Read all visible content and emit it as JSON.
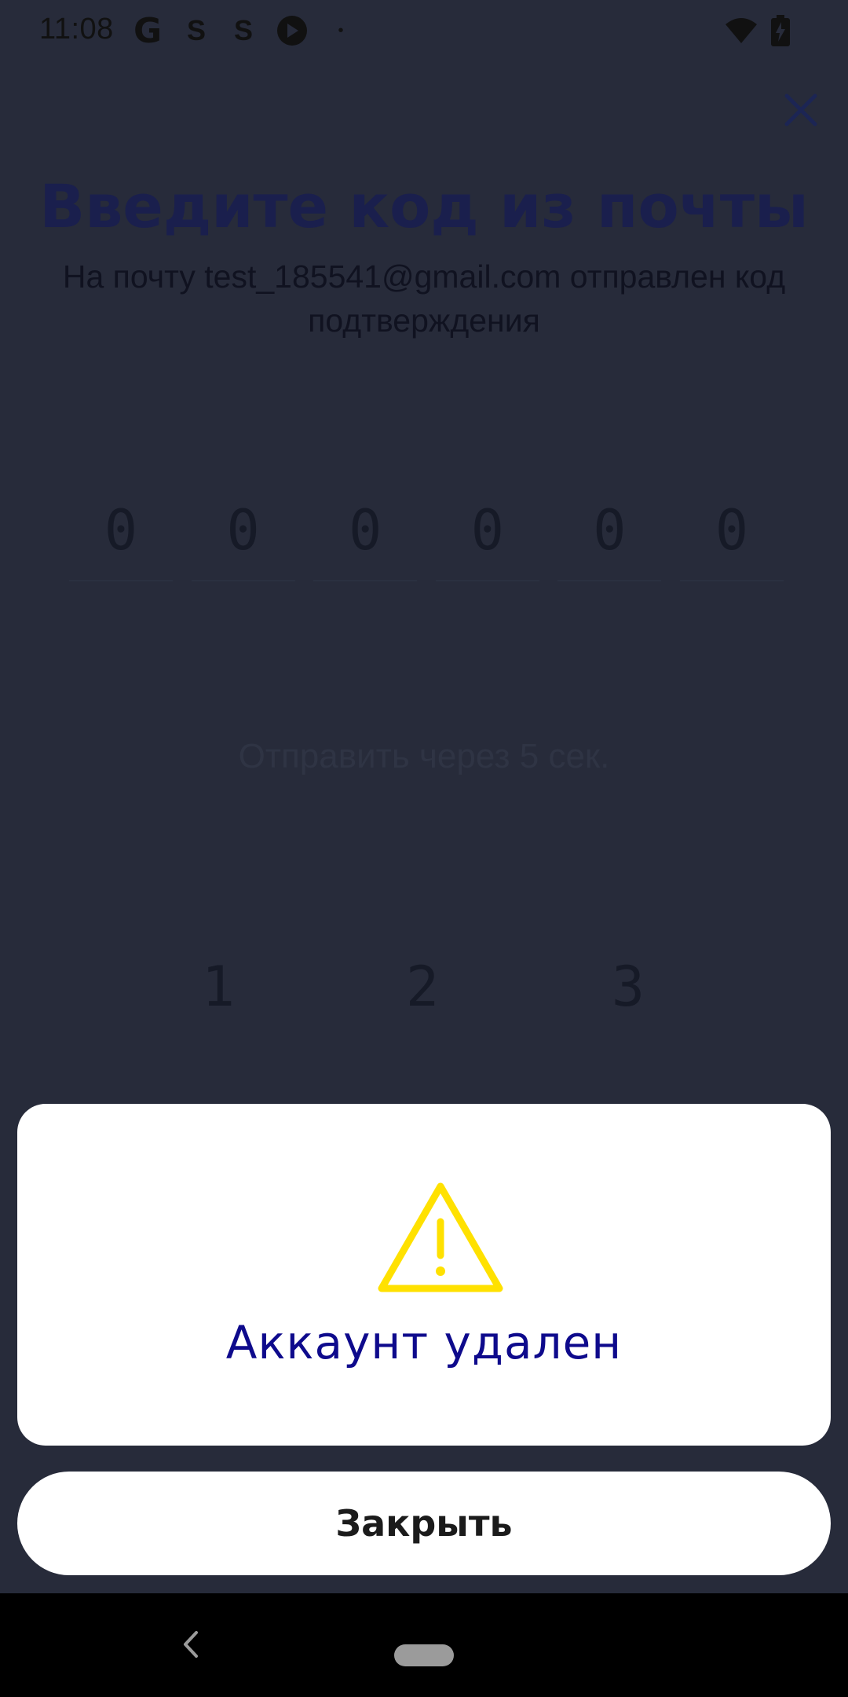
{
  "status_bar": {
    "time": "11:08",
    "icons": [
      "google-icon",
      "notification-s-icon",
      "notification-s-icon",
      "app-icon",
      "dot-icon",
      "wifi-icon",
      "battery-charging-icon"
    ]
  },
  "background": {
    "title": "Введите код из почты",
    "subtitle": "На почту test_185541@gmail.com отправлен код подтверждения",
    "code_digits": [
      "0",
      "0",
      "0",
      "0",
      "0",
      "0"
    ],
    "resend_text": "Отправить через 5 сек.",
    "keypad": [
      "1",
      "2",
      "3"
    ]
  },
  "alert": {
    "icon": "warning-icon",
    "title": "Аккаунт удален",
    "close_label": "Закрыть"
  },
  "colors": {
    "overlay_bg": "#272b3a",
    "alert_title": "#0e0a8c",
    "warning": "#ffe100"
  }
}
